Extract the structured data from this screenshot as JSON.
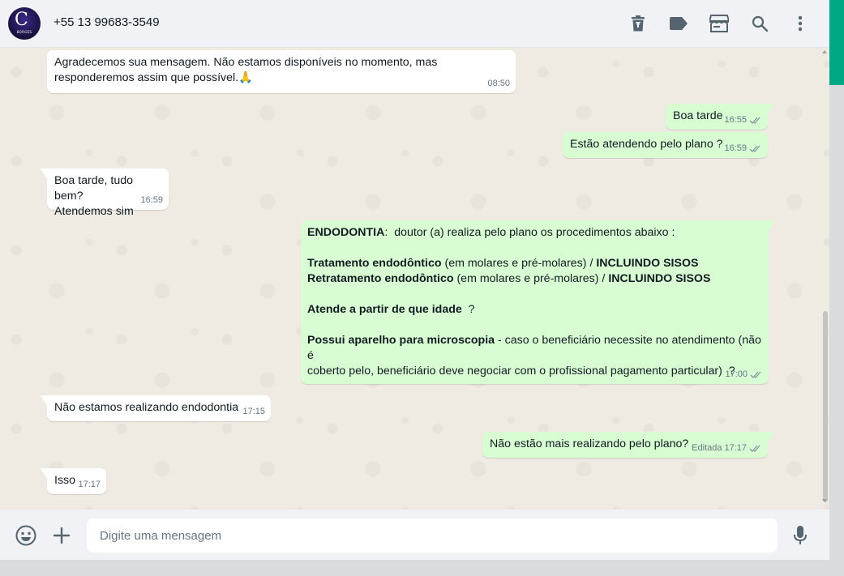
{
  "header": {
    "contact_name": "+55 13 99683-3549",
    "avatar_text": "C",
    "avatar_subtext": "BORGES",
    "icons": [
      "delete-icon",
      "label-icon",
      "store-icon",
      "search-icon",
      "menu-icon"
    ]
  },
  "messages": [
    {
      "dir": "in",
      "text": "Agradecemos sua mensagem. Não estamos disponíveis no momento, mas\nresponderemos assim que possível.🙏",
      "time": "08:50"
    },
    {
      "dir": "out",
      "text": "Boa tarde",
      "time": "16:55"
    },
    {
      "dir": "out",
      "text": "Estão atendendo pelo plano ?",
      "time": "16:59"
    },
    {
      "dir": "in",
      "text": "Boa tarde, tudo bem?\nAtendemos sim",
      "time": "16:59"
    },
    {
      "dir": "out",
      "time": "17:00",
      "line1_bold": "ENDODONTIA",
      "line1_rest": ":  doutor (a) realiza pelo plano os procedimentos abaixo :",
      "line2_bold": "Tratamento endodôntico",
      "line2_mid": " (em molares e pré-molares) / ",
      "line2_bold2": "INCLUINDO SISOS",
      "line3_bold": "Retratamento endodôntico",
      "line3_mid": " (em molares e pré-molares) / ",
      "line3_bold2": "INCLUINDO SISOS",
      "line4_bold": "Atende a partir de que idade",
      "line4_rest": "  ?",
      "line5_bold": "Possui aparelho para microscopia",
      "line5_rest": " - caso o beneficiário necessite no atendimento (não é",
      "line6": "coberto pelo, beneficiário deve negociar com o profissional pagamento particular)  ?"
    },
    {
      "dir": "in",
      "text": "Não estamos realizando endodontia",
      "time": "17:15"
    },
    {
      "dir": "out",
      "text": "Não estão mais realizando pelo plano?",
      "edited": "Editada",
      "time": "17:17"
    },
    {
      "dir": "in",
      "text": "Isso",
      "time": "17:17"
    }
  ],
  "composer": {
    "placeholder": "Digite uma mensagem",
    "icons": [
      "emoji-icon",
      "attach-plus-icon",
      "microphone-icon"
    ]
  },
  "colors": {
    "accent": "#00a884",
    "outgoing_bubble": "#d9fdd3",
    "incoming_bubble": "#ffffff",
    "chat_bg": "#efeae2",
    "header_bg": "#f0f2f5"
  }
}
